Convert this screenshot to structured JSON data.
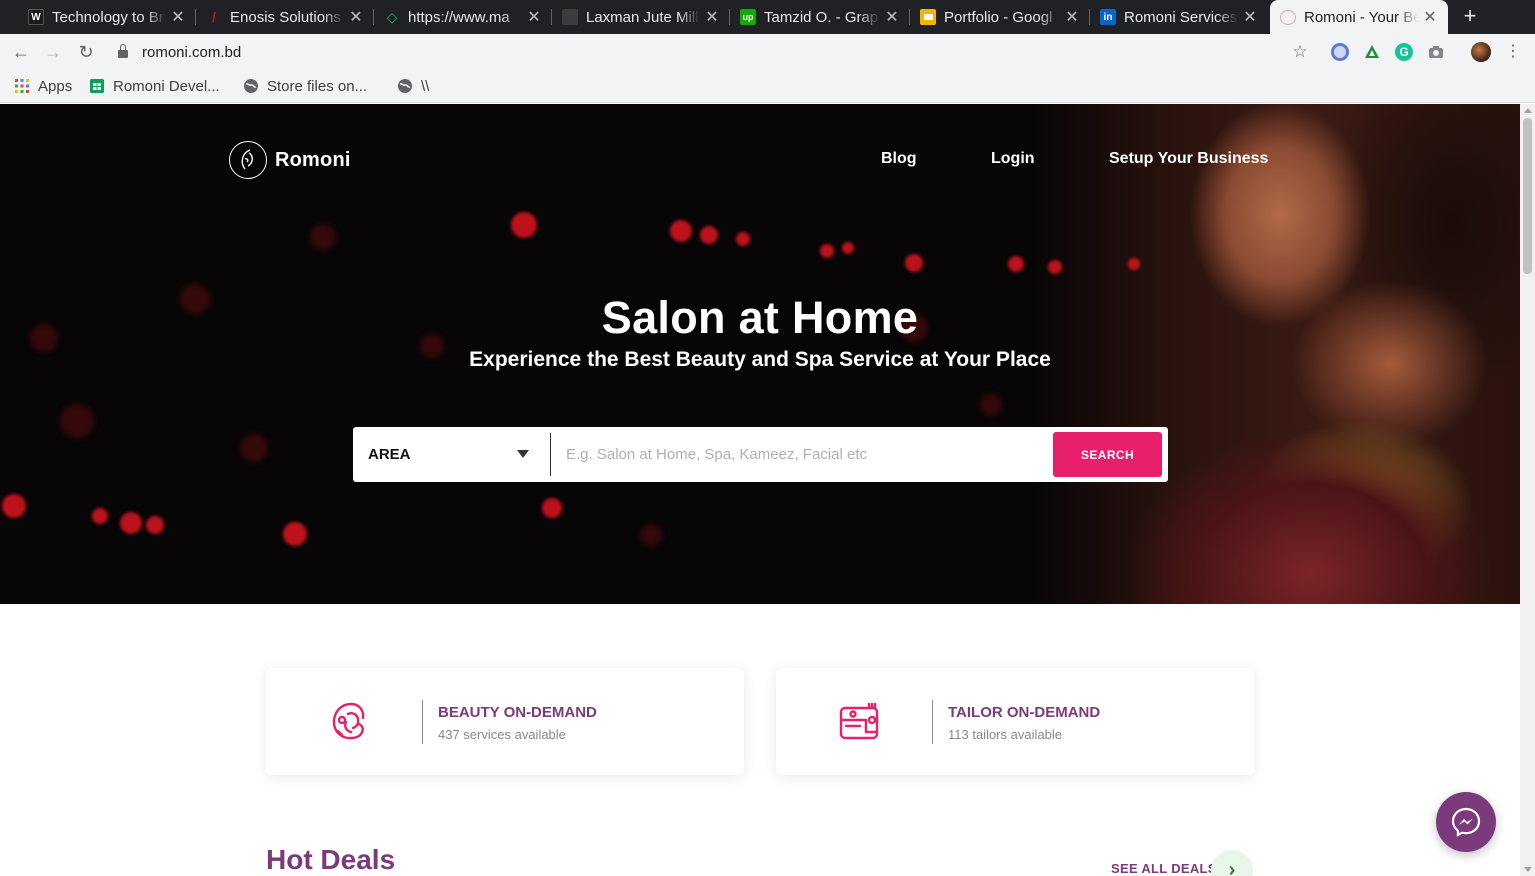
{
  "browser": {
    "tabs": [
      {
        "title": "Technology to Br",
        "favicon": "W",
        "color": "#1b1b1b",
        "active": false
      },
      {
        "title": "Enosis Solutions",
        "favicon": "E",
        "color": "#c4161c",
        "active": false
      },
      {
        "title": "https://www.ma",
        "favicon": "diamond",
        "color": "#1aa260",
        "active": false
      },
      {
        "title": "Laxman Jute Mill",
        "favicon": "",
        "color": "#3c3c3c",
        "active": false
      },
      {
        "title": "Tamzid O. - Grap",
        "favicon": "up",
        "color": "#14a800",
        "active": false
      },
      {
        "title": "Portfolio - Googl",
        "favicon": "slides",
        "color": "#f4b400",
        "active": false
      },
      {
        "title": "Romoni Services",
        "favicon": "in",
        "color": "#0a66c2",
        "active": false
      },
      {
        "title": "Romoni - Your Be",
        "favicon": "R",
        "color": "#e81f6a",
        "active": true
      }
    ],
    "new_tab": "+",
    "url": "romoni.com.bd",
    "bookmarks": [
      {
        "label": "Apps",
        "icon": "apps-grid-icon"
      },
      {
        "label": "Romoni Devel...",
        "icon": "sheets-icon"
      },
      {
        "label": "Store files on...",
        "icon": "globe-icon"
      },
      {
        "label": "\\\\",
        "icon": "globe-icon"
      }
    ]
  },
  "site": {
    "brand": "Romoni",
    "nav": [
      {
        "label": "Blog"
      },
      {
        "label": "Login"
      },
      {
        "label": "Setup Your Business"
      }
    ],
    "hero": {
      "title": "Salon at Home",
      "subtitle": "Experience the Best Beauty and Spa Service at Your Place"
    },
    "search": {
      "area_label": "AREA",
      "query_value": "",
      "query_placeholder": "E.g. Salon at Home, Spa, Kameez, Facial etc",
      "button": "SEARCH"
    },
    "services": [
      {
        "title": "BEAUTY ON-DEMAND",
        "subtitle": "437 services available",
        "icon": "beauty-face-icon"
      },
      {
        "title": "TAILOR ON-DEMAND",
        "subtitle": "113 tailors available",
        "icon": "sewing-machine-icon"
      }
    ],
    "hot_deals": {
      "title": "Hot Deals",
      "see_all": "SEE ALL DEALS"
    },
    "colors": {
      "accent_pink": "#e81f6a",
      "brand_purple": "#7b3a7b"
    }
  }
}
